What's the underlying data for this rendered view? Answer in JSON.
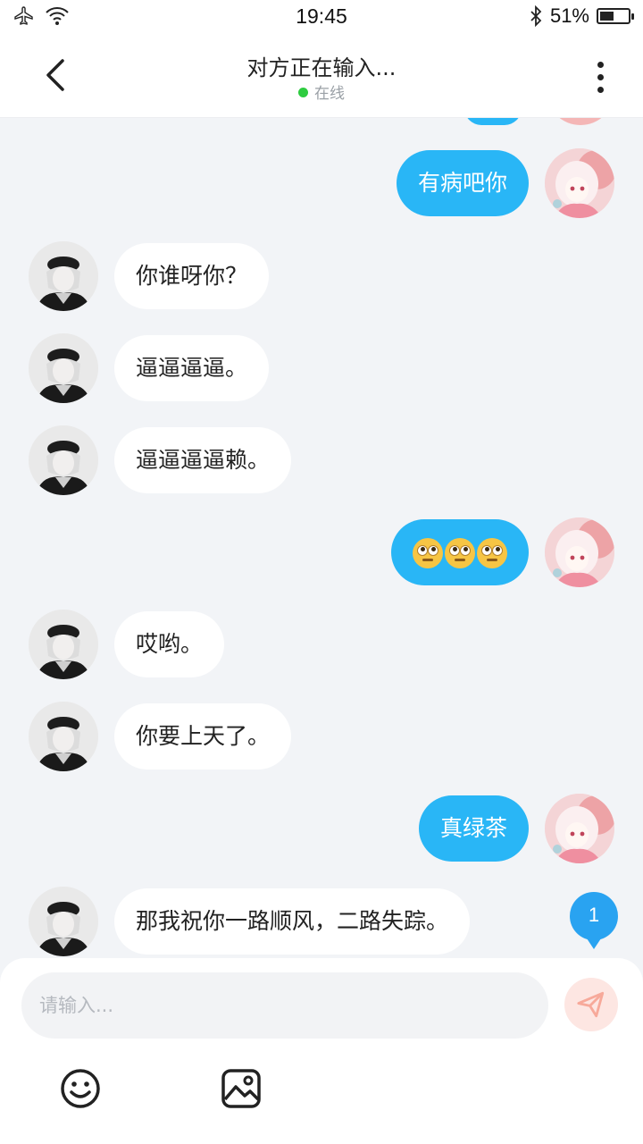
{
  "status_bar": {
    "time": "19:45",
    "battery_percent": "51%",
    "battery_level": 0.51
  },
  "header": {
    "title": "对方正在输入...",
    "status": "在线"
  },
  "messages": [
    {
      "side": "right",
      "text": "有病吧你"
    },
    {
      "side": "left",
      "text": "你谁呀你？"
    },
    {
      "side": "left",
      "text": "逼逼逼逼。"
    },
    {
      "side": "left",
      "text": "逼逼逼逼赖。"
    },
    {
      "side": "right",
      "text": "",
      "emoji": [
        "face-with-rolling-eyes",
        "face-with-rolling-eyes",
        "face-with-rolling-eyes"
      ]
    },
    {
      "side": "left",
      "text": "哎哟。"
    },
    {
      "side": "left",
      "text": "你要上天了。"
    },
    {
      "side": "right",
      "text": "真绿茶"
    },
    {
      "side": "left",
      "text": "那我祝你一路顺风，二路失踪。"
    }
  ],
  "unread_badge": "1",
  "input": {
    "placeholder": "请输入..."
  },
  "colors": {
    "accent": "#29b6f6",
    "online": "#2ecc40",
    "background": "#f2f4f7"
  },
  "icons": {
    "back": "chevron-left-icon",
    "more": "more-vertical-icon",
    "send": "send-icon",
    "emoji": "smiley-icon",
    "image": "image-icon"
  }
}
